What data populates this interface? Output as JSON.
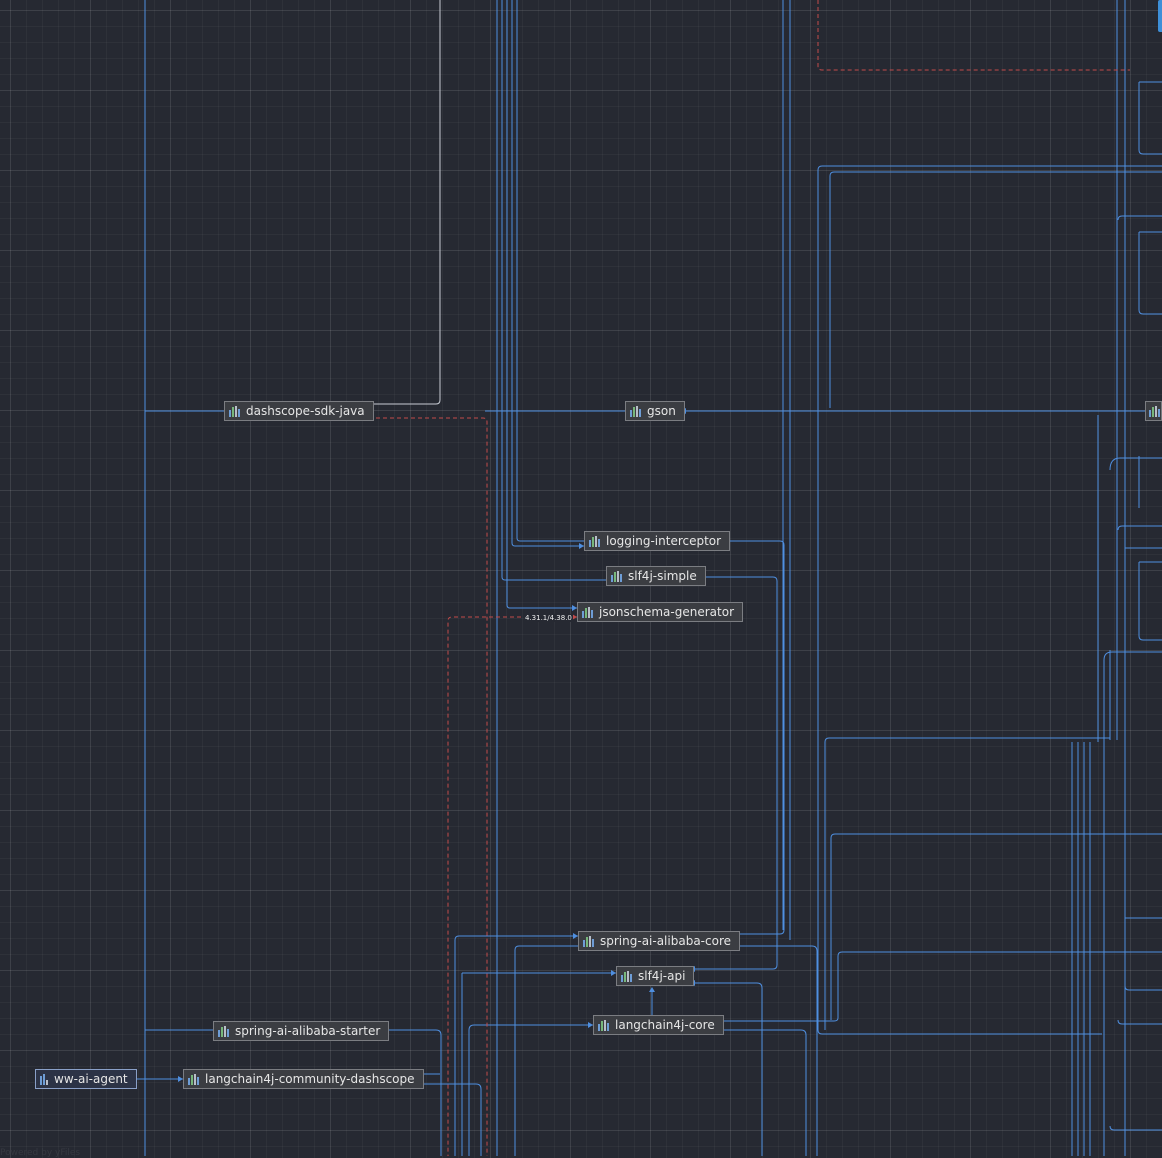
{
  "diagram": {
    "root": {
      "label": "ww-ai-agent",
      "icon": "module-icon"
    },
    "nodes": [
      {
        "id": "dashscope-sdk-java",
        "label": "dashscope-sdk-java",
        "icon": "library-icon"
      },
      {
        "id": "gson",
        "label": "gson",
        "icon": "library-icon"
      },
      {
        "id": "logging-interceptor",
        "label": "logging-interceptor",
        "icon": "library-icon"
      },
      {
        "id": "slf4j-simple",
        "label": "slf4j-simple",
        "icon": "library-icon"
      },
      {
        "id": "jsonschema-generator",
        "label": "jsonschema-generator",
        "icon": "library-icon"
      },
      {
        "id": "spring-ai-alibaba-core",
        "label": "spring-ai-alibaba-core",
        "icon": "library-icon"
      },
      {
        "id": "slf4j-api",
        "label": "slf4j-api",
        "icon": "library-icon"
      },
      {
        "id": "langchain4j-core",
        "label": "langchain4j-core",
        "icon": "library-icon"
      },
      {
        "id": "spring-ai-alibaba-starter",
        "label": "spring-ai-alibaba-starter",
        "icon": "library-icon"
      },
      {
        "id": "langchain4j-community-dashscope",
        "label": "langchain4j-community-dashscope",
        "icon": "library-icon"
      }
    ],
    "version_conflict_label": "4.31.1/4.38.0",
    "watermark": "Powered by yFiles",
    "colors": {
      "background": "#262932",
      "edge": "#4f8fe0",
      "conflict_edge": "#c24b4b",
      "node_fill": "#3b3d42",
      "node_border": "#7b7d82",
      "text": "#e6e6e6"
    }
  }
}
